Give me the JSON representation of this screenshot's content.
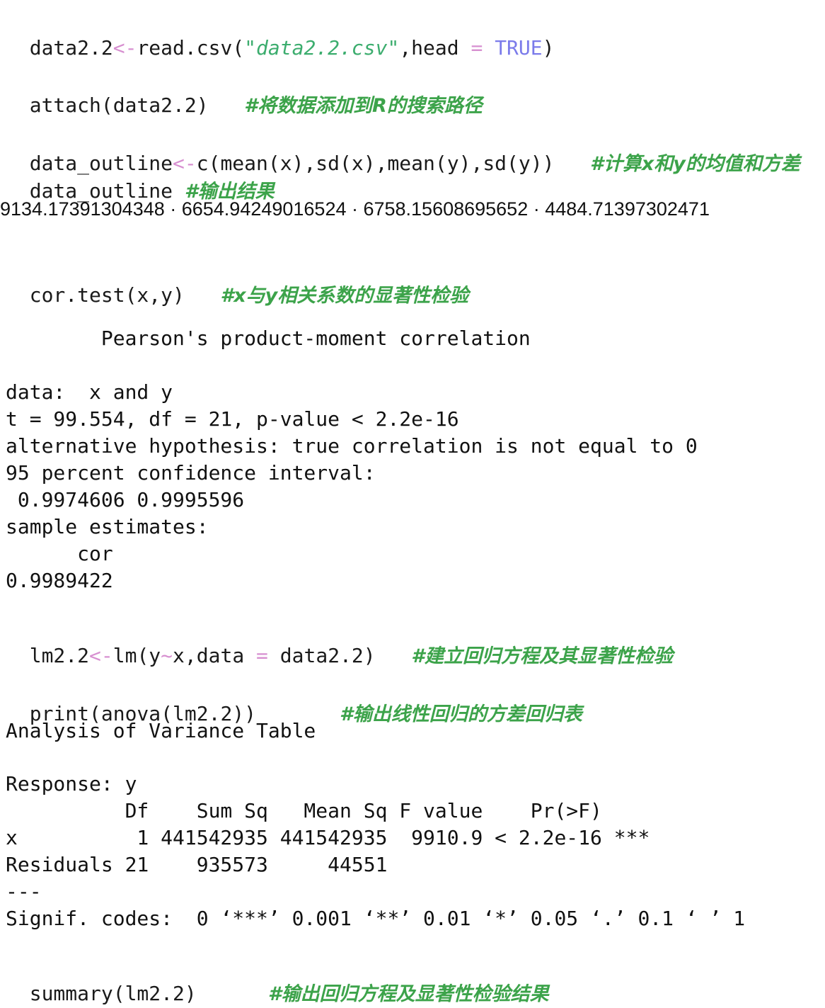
{
  "cells": {
    "read_csv": {
      "var": "data2.2",
      "assign": "<-",
      "fn": "read.csv(",
      "arg_str": "\"data2.2.csv\"",
      "mid": ",head ",
      "eq": "=",
      "bool": "TRUE",
      "close": ")"
    },
    "attach": {
      "code": "attach(data2.2)",
      "comment": "#将数据添加到R的搜索路径"
    },
    "outline": {
      "lhs": "data_outline",
      "assign": "<-",
      "rhs": "c(mean(x),sd(x),mean(y),sd(y))",
      "comment": "#计算x和y的均值和方差",
      "print_code": "data_outline",
      "print_comment": "#输出结果",
      "result": "9134.17391304348 · 6654.94249016524 · 6758.15608695652 · 4484.71397302471"
    },
    "cortest": {
      "code": "cor.test(x,y)",
      "comment": "#x与y相关系数的显著性检验",
      "output": [
        "        Pearson's product-moment correlation",
        "data:  x and y",
        "t = 99.554, df = 21, p-value < 2.2e-16",
        "alternative hypothesis: true correlation is not equal to 0",
        "95 percent confidence interval:",
        " 0.9974606 0.9995596",
        "sample estimates:",
        "      cor",
        "0.9989422"
      ]
    },
    "lm": {
      "lhs": "lm2.2",
      "assign": "<-",
      "fn": "lm(y",
      "tilde": "~",
      "mid": "x,data ",
      "eq": "=",
      "rest": " data2.2)",
      "comment": "#建立回归方程及其显著性检验"
    },
    "anova": {
      "code": "print(anova(lm2.2))",
      "comment": "#输出线性回归的方差回归表",
      "output": [
        "Analysis of Variance Table",
        "Response: y",
        "          Df    Sum Sq   Mean Sq F value    Pr(>F)    ",
        "x          1 441542935 441542935  9910.9 < 2.2e-16 ***",
        "Residuals 21    935573     44551                      ",
        "---",
        "Signif. codes:  0 ‘***’ 0.001 ‘**’ 0.01 ‘*’ 0.05 ‘.’ 0.1 ‘ ’ 1"
      ]
    },
    "summary": {
      "code": "summary(lm2.2)",
      "comment": "#输出回归方程及显著性检验结果"
    }
  }
}
